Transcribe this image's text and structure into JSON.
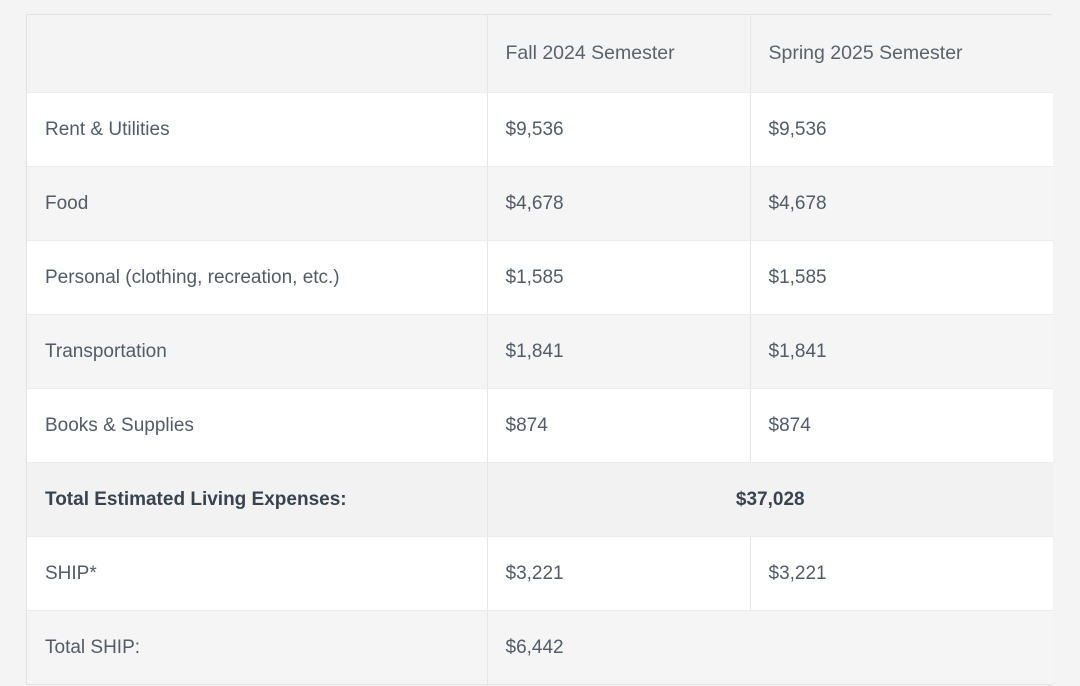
{
  "table": {
    "headers": {
      "label": "",
      "fall": "Fall 2024 Semester",
      "spring": "Spring 2025 Semester"
    },
    "rows": [
      {
        "label": "Rent & Utilities",
        "fall": "$9,536",
        "spring": "$9,536",
        "merged": false,
        "bold": false
      },
      {
        "label": "Food",
        "fall": "$4,678",
        "spring": "$4,678",
        "merged": false,
        "bold": false
      },
      {
        "label": "Personal (clothing, recreation, etc.)",
        "fall": "$1,585",
        "spring": "$1,585",
        "merged": false,
        "bold": false
      },
      {
        "label": "Transportation",
        "fall": "$1,841",
        "spring": "$1,841",
        "merged": false,
        "bold": false
      },
      {
        "label": "Books & Supplies",
        "fall": "$874",
        "spring": "$874",
        "merged": false,
        "bold": false
      },
      {
        "label": "Total Estimated Living Expenses:",
        "merged_value": "$37,028",
        "merged": true,
        "bold": true,
        "align": "center"
      },
      {
        "label": "SHIP*",
        "fall": "$3,221",
        "spring": "$3,221",
        "merged": false,
        "bold": false
      },
      {
        "label": "Total SHIP:",
        "merged_value": "$6,442",
        "merged": true,
        "bold": false,
        "align": "left"
      }
    ]
  },
  "colors": {
    "page_background": "#f4f4f4",
    "table_background": "#ffffff",
    "stripe_background": "#f5f5f5",
    "header_background": "#f4f4f5",
    "total_row_background": "#f2f2f3",
    "border": "#ececee",
    "divider": "#e6e6e8",
    "text": "#525b66",
    "text_strong": "#39434f",
    "header_text": "#5a626c"
  }
}
